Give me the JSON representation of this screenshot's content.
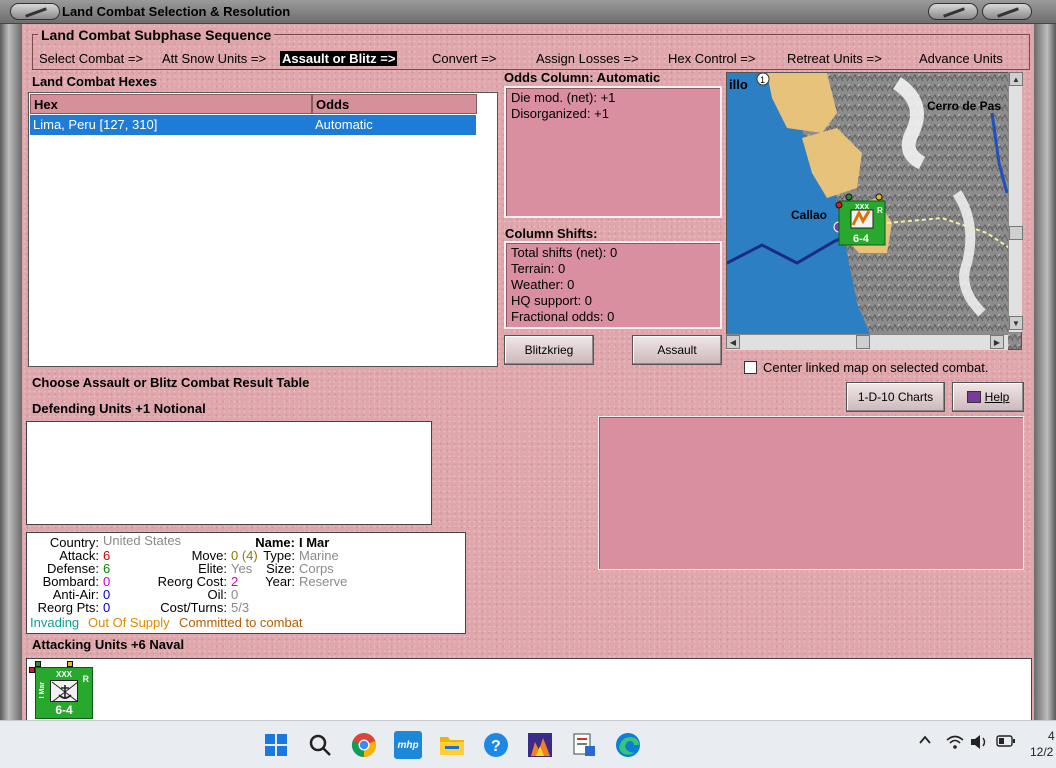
{
  "window": {
    "title": "Land Combat Selection & Resolution"
  },
  "sequence": {
    "title": "Land Combat Subphase Sequence",
    "items": [
      "Select Combat =>",
      "Att Snow Units =>",
      "Assault or Blitz =>",
      "Convert =>",
      "Assign Losses =>",
      "Hex Control =>",
      "Retreat Units =>",
      "Advance Units"
    ],
    "active_index": 2
  },
  "hexes": {
    "title": "Land Combat Hexes",
    "columns": [
      "Hex",
      "Odds"
    ],
    "rows": [
      {
        "hex": "Lima, Peru [127, 310]",
        "odds": "Automatic"
      }
    ]
  },
  "odds": {
    "title": "Odds Column: Automatic",
    "lines": [
      "Die mod. (net): +1",
      "Disorganized: +1"
    ]
  },
  "shifts": {
    "title": "Column Shifts:",
    "lines": [
      "Total shifts (net): 0",
      "Terrain: 0",
      "Weather: 0",
      "HQ support: 0",
      "Fractional odds: 0"
    ]
  },
  "buttons": {
    "blitzkrieg": "Blitzkrieg",
    "assault": "Assault",
    "charts": "1-D-10 Charts",
    "help": "Help"
  },
  "map": {
    "labels": {
      "top_left": "illo",
      "top_right": "Cerro de Pas",
      "port": "Callao"
    },
    "marker_number": "1"
  },
  "center_option": "Center linked map on selected combat.",
  "crt_title": "Choose Assault or Blitz Combat Result Table",
  "defending_title": "Defending Units +1 Notional",
  "attacking_title": "Attacking Units +6 Naval",
  "unit": {
    "country_label": "Country:",
    "country": "United States",
    "attack_label": "Attack:",
    "attack": "6",
    "defense_label": "Defense:",
    "defense": "6",
    "bombard_label": "Bombard:",
    "bombard": "0",
    "antiair_label": "Anti-Air:",
    "antiair": "0",
    "reorgpts_label": "Reorg Pts:",
    "reorgpts": "0",
    "name_label": "Name:",
    "name": "I Mar",
    "move_label": "Move:",
    "move": "0 (4)",
    "elite_label": "Elite:",
    "elite": "Yes",
    "reorgcost_label": "Reorg Cost:",
    "reorgcost": "2",
    "oil_label": "Oil:",
    "oil": "0",
    "costturns_label": "Cost/Turns:",
    "costturns": "5/3",
    "type_label": "Type:",
    "type": "Marine",
    "size_label": "Size:",
    "size": "Corps",
    "year_label": "Year:",
    "year": "Reserve",
    "status_invading": "Invading",
    "status_supply": "Out Of Supply",
    "status_committed": "Committed to combat"
  },
  "counter": {
    "size": "XXX",
    "name": "I Mar",
    "reserve": "R",
    "strength": "6-4"
  },
  "colors": {
    "panel": "#dfa6ac",
    "selected_row": "#1e7cd6",
    "counter_green": "#29a82e",
    "value_red": "#d00000",
    "value_green": "#008800",
    "value_magenta": "#cc00cc",
    "value_blue": "#0000cc",
    "value_grey": "#8a8a8a",
    "value_olive": "#8a7a00",
    "value_orange": "#e08a00",
    "value_brown": "#b85c00",
    "status_teal": "#10a090"
  },
  "taskbar": {
    "icons": [
      "start-icon",
      "search-icon",
      "chrome-icon",
      "mhp-icon",
      "folder-icon",
      "help-icon",
      "game-icon",
      "tool-icon",
      "edge-icon"
    ],
    "mhp_label": "mhp",
    "time_fragment": "4",
    "date_fragment": "12/2"
  }
}
